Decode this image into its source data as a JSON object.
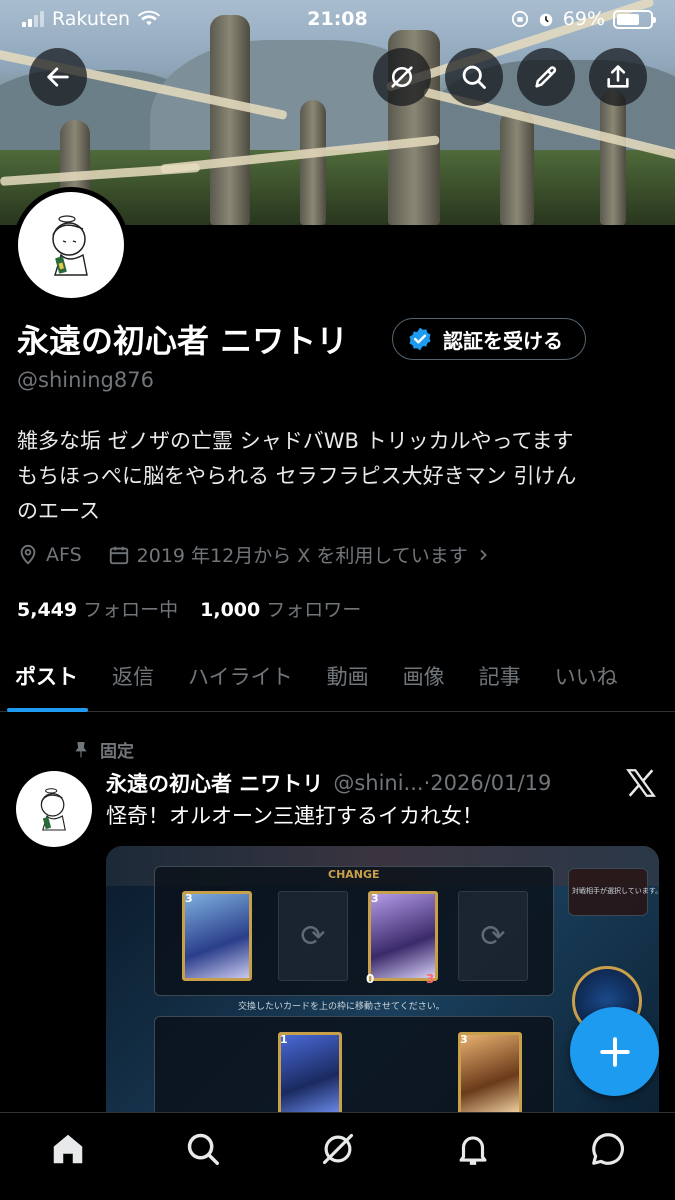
{
  "status_bar": {
    "carrier": "Rakuten",
    "time": "21:08",
    "battery_percent": "69%",
    "battery_level": 0.69
  },
  "header": {
    "back_icon": "arrow-left-icon",
    "actions": [
      "grok-icon",
      "search-icon",
      "edit-icon",
      "share-icon"
    ]
  },
  "profile": {
    "display_name": "永遠の初心者 ニワトリ",
    "verify_label": "認証を受ける",
    "handle": "@shining876",
    "bio_lines": [
      "雑多な垢 ゼノザの亡霊 シャドバWB トリッカルやってます",
      "もちほっぺに脳をやられる セラフラピス大好きマン 引けん",
      "のエース"
    ],
    "location": "AFS",
    "joined": "2019 年12月から X を利用しています",
    "following_count": "5,449",
    "following_label": "フォロー中",
    "followers_count": "1,000",
    "followers_label": "フォロワー"
  },
  "tabs": [
    "ポスト",
    "返信",
    "ハイライト",
    "動画",
    "画像",
    "記事",
    "いいね"
  ],
  "post": {
    "pinned_label": "固定",
    "author_name": "永遠の初心者 ニワトリ",
    "author_handle": "@shini...",
    "separator": "·",
    "date": "2026/01/19",
    "text": "怪奇！オルオーン三連打するイカれ女！",
    "media": {
      "change_label": "CHANGE",
      "instruction": "交換したいカードを上の枠に移動させてください。",
      "opponent_note": "対戦相手が選択しています。",
      "card1_cost": "3",
      "card2_cost": "3",
      "card2_attack": "0",
      "card2_life": "3",
      "card3_cost": "1",
      "card4_cost": "3"
    }
  },
  "bottom_nav": [
    "home-icon",
    "search-icon",
    "grok-icon",
    "notifications-icon",
    "messages-icon"
  ],
  "colors": {
    "accent": "#1d9bf0",
    "background": "#000000",
    "muted": "#71767b"
  }
}
